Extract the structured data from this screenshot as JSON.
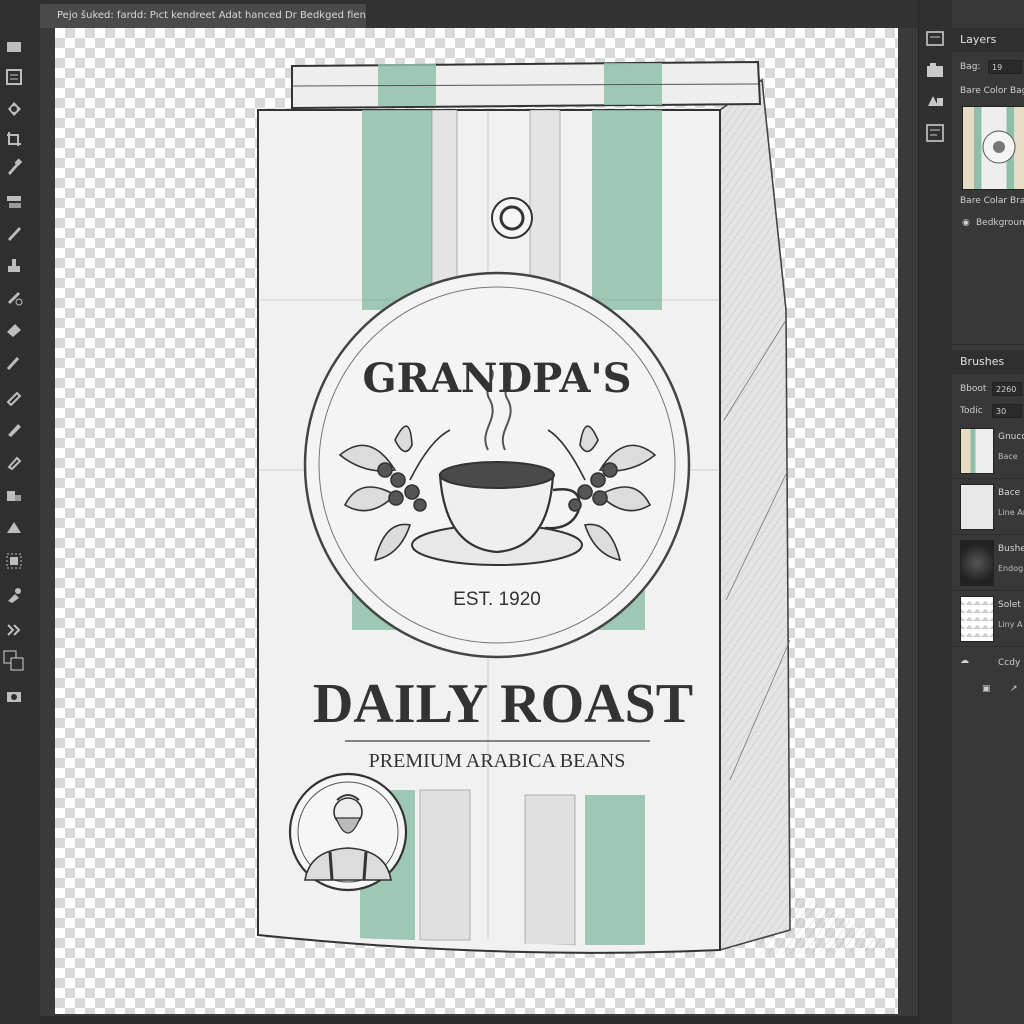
{
  "document_tab": {
    "title": "Pejo šuked: fardd: Pıct kendreet Adat hanced Dr Bedkged fiens"
  },
  "toolbar": {
    "tools": [
      "move-icon",
      "artboard-icon",
      "lasso-icon",
      "crop-icon",
      "eyedropper-icon",
      "healing-icon",
      "brush-icon",
      "stamp-icon",
      "history-brush-icon",
      "eraser-icon",
      "gradient-icon",
      "smudge-icon",
      "pen-icon",
      "text-icon",
      "path-select-icon",
      "shape-icon",
      "hand-icon",
      "zoom-icon",
      "extra-tools-icon",
      "edit-toolbar-icon",
      "foreground-background-swatch-icon",
      "quick-mask-icon"
    ]
  },
  "artwork": {
    "brand": "GRANDPA'S",
    "established": "EST. 1920",
    "product": "DAILY ROAST",
    "tagline": "PREMIUM ARABICA BEANS"
  },
  "right_icons": [
    "history-icon",
    "properties-icon",
    "adjustments-icon",
    "libraries-icon",
    "swatches-icon"
  ],
  "layers_panel": {
    "tab": "Layers",
    "rows": [
      {
        "label": "Bag:",
        "value": "19"
      },
      {
        "label": "Bare Color Bage",
        "value": ""
      }
    ],
    "layer_name": "Bare Colar Brach",
    "background_layer": "Bedkground"
  },
  "brushes_panel": {
    "tab": "Brushes",
    "fields": [
      {
        "label": "Bboot",
        "value": "2260"
      },
      {
        "label": "Todic",
        "value": "30"
      }
    ],
    "items": [
      {
        "name": "Gnuco",
        "sub": "Bace"
      },
      {
        "name": "Bace",
        "sub": "Line Ar"
      },
      {
        "name": "Bushe",
        "sub": "Endog"
      },
      {
        "name": "Solet",
        "sub": "Liny A"
      }
    ],
    "footer": "Ccdy"
  },
  "colors": {
    "accent_green": "#8fbfaa",
    "ink": "#333333",
    "paper": "#f1f1f1"
  }
}
